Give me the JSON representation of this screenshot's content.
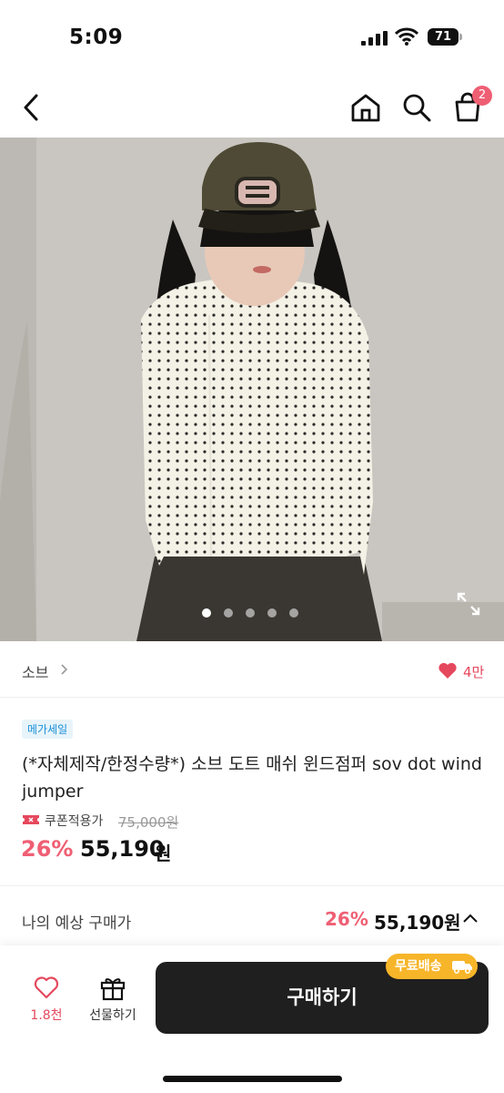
{
  "status_bar": {
    "time": "5:09",
    "battery": "71"
  },
  "nav": {
    "cart_count": "2"
  },
  "gallery": {
    "slide_count": 5,
    "active_slide": 1
  },
  "brand": {
    "name": "소브",
    "likes": "4만"
  },
  "product": {
    "badge": "메가세일",
    "title": "(*자체제작/한정수량*) 소브 도트 매쉬 윈드점퍼 sov dot wind jumper",
    "coupon_label": "쿠폰적용가",
    "original_price": "75,000원",
    "discount": "26%",
    "price": "55,190",
    "currency": "원"
  },
  "estimate": {
    "label": "나의 예상 구매가",
    "discount": "26%",
    "price": "55,190원"
  },
  "bottom": {
    "wish_count": "1.8천",
    "gift_label": "선물하기",
    "buy_label": "구매하기",
    "shipping_tag": "무료배송"
  },
  "colors": {
    "accent": "#ef5f74",
    "buy_button": "#1f1f1f",
    "shipping_tag": "#f7b529",
    "badge_text": "#1a8fd6"
  }
}
